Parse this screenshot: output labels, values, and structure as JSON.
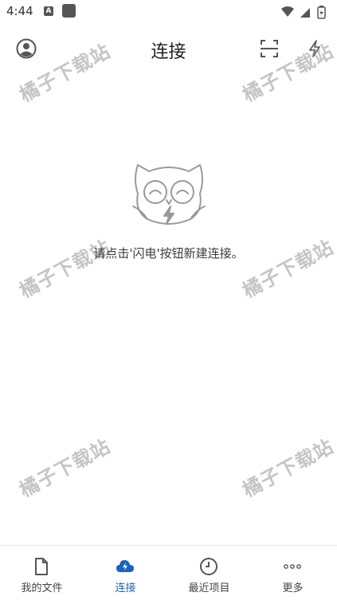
{
  "status_bar": {
    "time": "4:44",
    "notif_letter": "A"
  },
  "app_bar": {
    "title": "连接",
    "account_icon": "account-icon",
    "scan_icon": "scan-icon",
    "flash_icon": "flash-icon"
  },
  "watermark": "橘子下载站",
  "empty_state": {
    "message": "请点击'闪电'按钮新建连接。",
    "illustration": "owl-icon"
  },
  "bottom_nav": {
    "items": [
      {
        "label": "我的文件",
        "icon": "file-icon",
        "active": false
      },
      {
        "label": "连接",
        "icon": "cloud-icon",
        "active": true
      },
      {
        "label": "最近项目",
        "icon": "clock-icon",
        "active": false
      },
      {
        "label": "更多",
        "icon": "more-icon",
        "active": false
      }
    ]
  },
  "colors": {
    "accent": "#1565c0",
    "icon": "#555555",
    "text": "#202124"
  }
}
